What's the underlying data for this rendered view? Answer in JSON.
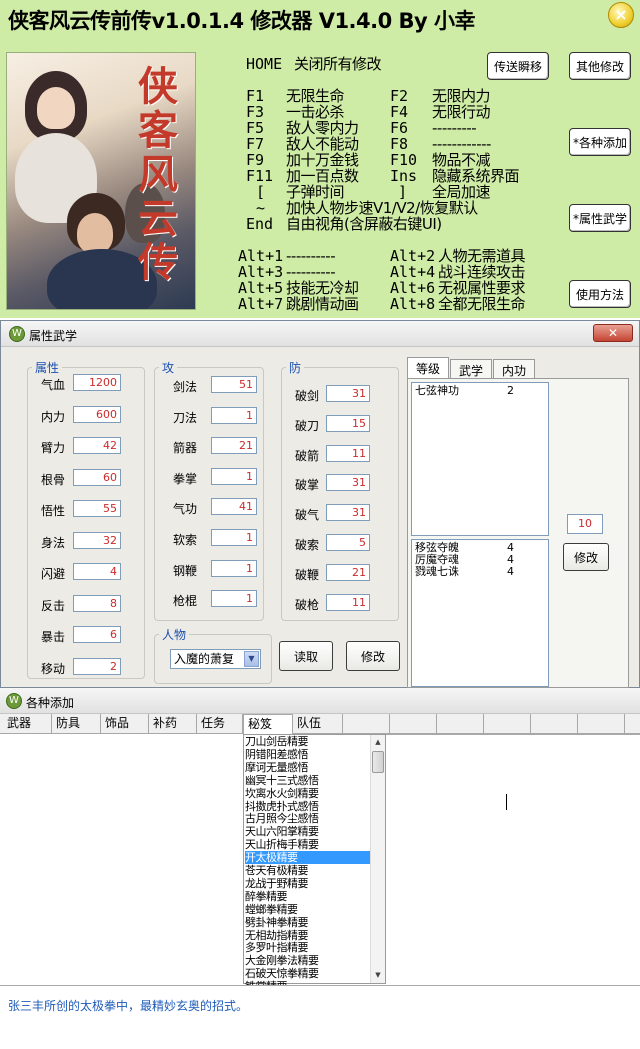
{
  "trainer": {
    "title": "侠客风云传前传v1.0.1.4 修改器 V1.4.0 By 小幸",
    "close_glyph": "×",
    "cover_glyph": "侠客风云传",
    "home_key": "HOME",
    "home_desc": "关闭所有修改",
    "hotkeys": [
      {
        "key": "F1",
        "desc": "无限生命",
        "key2": "F2",
        "desc2": "无限内力"
      },
      {
        "key": "F3",
        "desc": "一击必杀",
        "key2": "F4",
        "desc2": "无限行动"
      },
      {
        "key": "F5",
        "desc": "敌人零内力",
        "key2": "F6",
        "desc2": "---------"
      },
      {
        "key": "F7",
        "desc": "敌人不能动",
        "key2": "F8",
        "desc2": "------------"
      },
      {
        "key": "F9",
        "desc": "加十万金钱",
        "key2": "F10",
        "desc2": "物品不减"
      },
      {
        "key": "F11",
        "desc": "加一百点数",
        "key2": "Ins",
        "desc2": "隐藏系统界面"
      },
      {
        "key": "[",
        "desc": "子弹时间",
        "key2": "]",
        "desc2": "全局加速"
      },
      {
        "key": "~",
        "desc": "加快人物步速V1/V2/恢复默认",
        "key2": "",
        "desc2": ""
      },
      {
        "key": "End",
        "desc": "自由视角(含屏蔽右键UI)",
        "key2": "",
        "desc2": ""
      }
    ],
    "alt_hotkeys": [
      {
        "key": "Alt+1",
        "desc": "----------",
        "key2": "Alt+2",
        "desc2": "人物无需道具"
      },
      {
        "key": "Alt+3",
        "desc": "----------",
        "key2": "Alt+4",
        "desc2": "战斗连续攻击"
      },
      {
        "key": "Alt+5",
        "desc": "技能无冷却",
        "key2": "Alt+6",
        "desc2": "无视属性要求"
      },
      {
        "key": "Alt+7",
        "desc": "跳剧情动画",
        "key2": "Alt+8",
        "desc2": "全都无限生命"
      }
    ],
    "buttons": {
      "teleport": "传送瞬移",
      "other": "其他修改",
      "add_items": "*各种添加",
      "attributes": "*属性武学",
      "usage": "使用方法"
    }
  },
  "attr_window": {
    "title": "属性武学",
    "close_glyph": "✕",
    "app_icon_glyph": "W",
    "groups": {
      "attributes": {
        "legend": "属性",
        "fields": [
          {
            "label": "气血",
            "value": "1200"
          },
          {
            "label": "内力",
            "value": "600"
          },
          {
            "label": "臂力",
            "value": "42"
          },
          {
            "label": "根骨",
            "value": "60"
          },
          {
            "label": "悟性",
            "value": "55"
          },
          {
            "label": "身法",
            "value": "32"
          },
          {
            "label": "闪避",
            "value": "4"
          },
          {
            "label": "反击",
            "value": "8"
          },
          {
            "label": "暴击",
            "value": "6"
          },
          {
            "label": "移动",
            "value": "2"
          }
        ]
      },
      "attack": {
        "legend": "攻",
        "fields": [
          {
            "label": "剑法",
            "value": "51"
          },
          {
            "label": "刀法",
            "value": "1"
          },
          {
            "label": "箭器",
            "value": "21"
          },
          {
            "label": "拳掌",
            "value": "1"
          },
          {
            "label": "气功",
            "value": "41"
          },
          {
            "label": "软索",
            "value": "1"
          },
          {
            "label": "钢鞭",
            "value": "1"
          },
          {
            "label": "枪棍",
            "value": "1"
          }
        ]
      },
      "defense": {
        "legend": "防",
        "fields": [
          {
            "label": "破剑",
            "value": "31"
          },
          {
            "label": "破刀",
            "value": "15"
          },
          {
            "label": "破箭",
            "value": "11"
          },
          {
            "label": "破掌",
            "value": "31"
          },
          {
            "label": "破气",
            "value": "31"
          },
          {
            "label": "破索",
            "value": "5"
          },
          {
            "label": "破鞭",
            "value": "21"
          },
          {
            "label": "破枪",
            "value": "11"
          }
        ]
      },
      "character": {
        "legend": "人物",
        "selected": "入魔的萧复",
        "dropdown_glyph": "▼"
      }
    },
    "buttons": {
      "read": "读取",
      "modify": "修改",
      "modify_skill": "修改"
    },
    "tabs": [
      "等级",
      "武学",
      "内功"
    ],
    "level_list": [
      {
        "name": "七弦神功",
        "level": "2"
      }
    ],
    "skill_list": [
      {
        "name": "移弦夺魄",
        "level": "4"
      },
      {
        "name": "厉魔夺魂",
        "level": "4"
      },
      {
        "name": "戮魂七诛",
        "level": "4"
      }
    ],
    "level_value": "10"
  },
  "add_window": {
    "title": "各种添加",
    "app_icon_glyph": "W",
    "tabs": [
      "武器",
      "防具",
      "饰品",
      "补药",
      "任务",
      "秘笈",
      "队伍"
    ],
    "active_tab": "秘笈",
    "scroll_up_glyph": "▲",
    "scroll_down_glyph": "▼",
    "skills": [
      "刀山剑岳精要",
      "阴错阳差感悟",
      "摩诃无量感悟",
      "幽冥十三式感悟",
      "坎离水火剑精要",
      "抖擞虎扑式感悟",
      "古月照今尘感悟",
      "天山六阳掌精要",
      "天山折梅手精要",
      "开太极精要",
      "苍天有极精要",
      "龙战于野精要",
      "醉拳精要",
      "螳螂拳精要",
      "劈卦神拳精要",
      "无相劫指精要",
      "多罗叶指精要",
      "大金刚拳法精要",
      "石破天惊拳精要",
      "铁掌精要"
    ],
    "selected_skill": "开太极精要",
    "description": "张三丰所创的太极拳中，最精妙玄奥的招式。"
  },
  "colors": {
    "trainer_bg": "#cfeca6",
    "legend_blue": "#1e4fb0",
    "value_red": "#cc2b2b",
    "selection_blue": "#3399ff",
    "description_blue": "#1d5bb8"
  }
}
